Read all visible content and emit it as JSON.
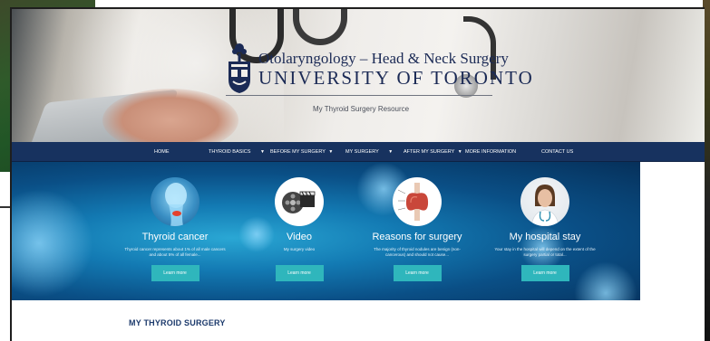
{
  "hero": {
    "title_line1": "Otolaryngology – Head & Neck Surgery",
    "title_line2": "UNIVERSITY OF TORONTO",
    "subtitle": "My Thyroid Surgery Resource"
  },
  "nav": {
    "items": [
      {
        "label": "HOME",
        "has_dropdown": false
      },
      {
        "label": "THYROID BASICS",
        "has_dropdown": true
      },
      {
        "label": "BEFORE MY SURGERY",
        "has_dropdown": true
      },
      {
        "label": "MY SURGERY",
        "has_dropdown": true
      },
      {
        "label": "AFTER MY SURGERY",
        "has_dropdown": true
      },
      {
        "label": "MORE INFORMATION",
        "has_dropdown": false
      },
      {
        "label": "CONTACT US",
        "has_dropdown": false
      }
    ],
    "caret": "▼"
  },
  "features": [
    {
      "title": "Thyroid cancer",
      "desc": "Thyroid cancer represents about 1% of all male cancers and about 5% of all female...",
      "button": "Learn more",
      "icon": "thyroid-anatomy-icon"
    },
    {
      "title": "Video",
      "desc": "My surgery video",
      "button": "Learn more",
      "icon": "film-reel-icon"
    },
    {
      "title": "Reasons for surgery",
      "desc": "The majority of thyroid nodules are benign (non-cancerous) and should not cause...",
      "button": "Learn more",
      "icon": "thyroid-gland-icon"
    },
    {
      "title": "My hospital stay",
      "desc": "Your stay in the hospital will depend on the extent of the surgery partial or total...",
      "button": "Learn more",
      "icon": "nurse-icon"
    }
  ],
  "section": {
    "title": "MY THYROID SURGERY"
  },
  "colors": {
    "nav_bg": "#17325f",
    "button": "#2fb6bc",
    "heading": "#1c3a6c",
    "band": "#137ab3"
  }
}
